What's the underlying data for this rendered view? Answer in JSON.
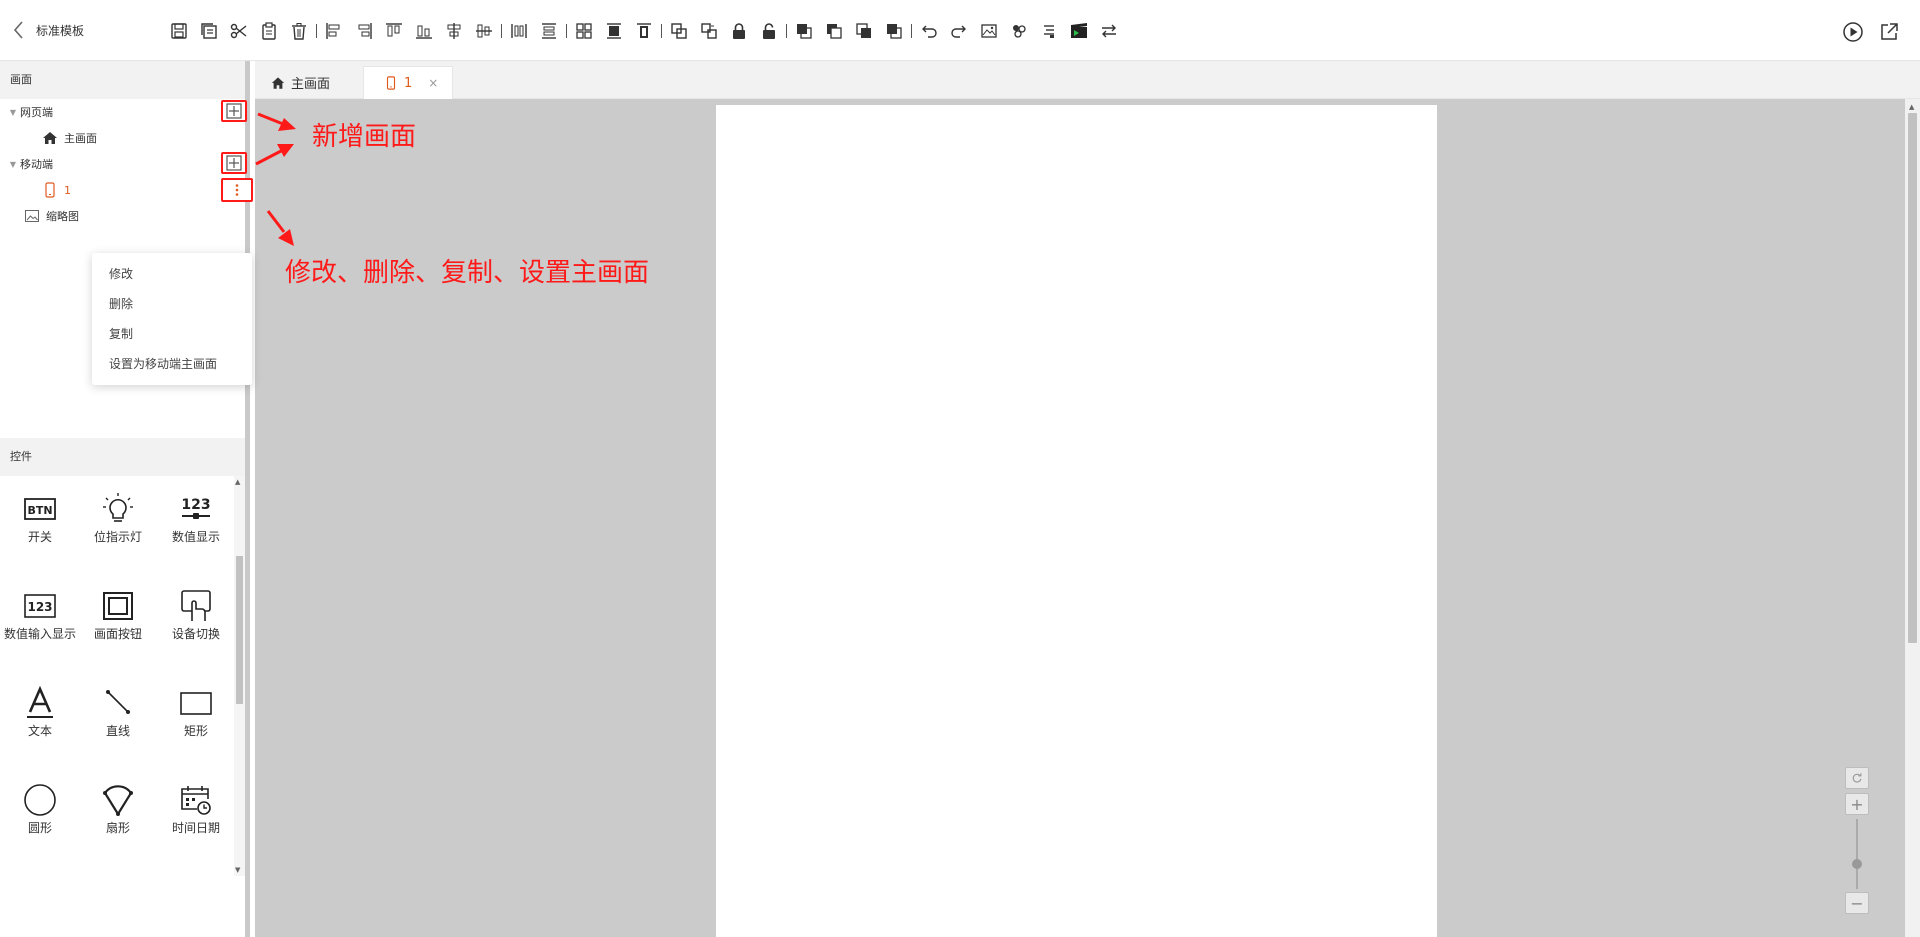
{
  "header": {
    "template_name": "标准模板",
    "toolbar_icons": [
      "save-icon",
      "save-as-icon",
      "cut-icon",
      "paste-icon",
      "delete-icon",
      "align-left-icon",
      "align-right-icon",
      "align-top-icon",
      "align-bottom-icon",
      "align-center-horizontal-icon",
      "align-center-vertical-icon",
      "distribute-horizontal-icon",
      "distribute-vertical-icon",
      "same-size-icon",
      "same-height-icon",
      "same-width-icon",
      "group-icon",
      "ungroup-icon",
      "lock-icon",
      "unlock-icon",
      "bring-front-icon",
      "send-back-icon",
      "bring-forward-icon",
      "send-backward-icon",
      "undo-icon",
      "redo-icon",
      "image-icon",
      "layers-icon",
      "properties-icon",
      "animation-icon",
      "swap-icon"
    ],
    "run_icon": "play-icon",
    "open_icon": "external-link-icon"
  },
  "sidebar": {
    "screens_title": "画面",
    "web_group": "网页端",
    "web_main": "主画面",
    "mobile_group": "移动端",
    "mobile_page": "1",
    "thumbnail": "缩略图"
  },
  "context_menu": {
    "items": [
      "修改",
      "删除",
      "复制",
      "设置为移动端主画面"
    ]
  },
  "controls": {
    "title": "控件",
    "items": [
      {
        "label": "开关",
        "icon": "btn-switch-icon"
      },
      {
        "label": "位指示灯",
        "icon": "bulb-indicator-icon"
      },
      {
        "label": "数值显示",
        "icon": "numeric-display-icon"
      },
      {
        "label": "数值输入显示",
        "icon": "numeric-input-icon"
      },
      {
        "label": "画面按钮",
        "icon": "screen-button-icon"
      },
      {
        "label": "设备切换",
        "icon": "device-switch-icon"
      },
      {
        "label": "文本",
        "icon": "text-icon"
      },
      {
        "label": "直线",
        "icon": "line-icon"
      },
      {
        "label": "矩形",
        "icon": "rectangle-icon"
      },
      {
        "label": "圆形",
        "icon": "circle-icon"
      },
      {
        "label": "扇形",
        "icon": "sector-icon"
      },
      {
        "label": "时间日期",
        "icon": "datetime-icon"
      }
    ]
  },
  "tabs": {
    "home": "主画面",
    "active": "1",
    "close": "×"
  },
  "annotations": {
    "add_screen": "新增画面",
    "menu_actions": "修改、删除、复制、设置主画面",
    "color": "#ff1a1a"
  },
  "colors": {
    "accent": "#e05a1e",
    "canvas_bg": "#cbcbcb"
  }
}
